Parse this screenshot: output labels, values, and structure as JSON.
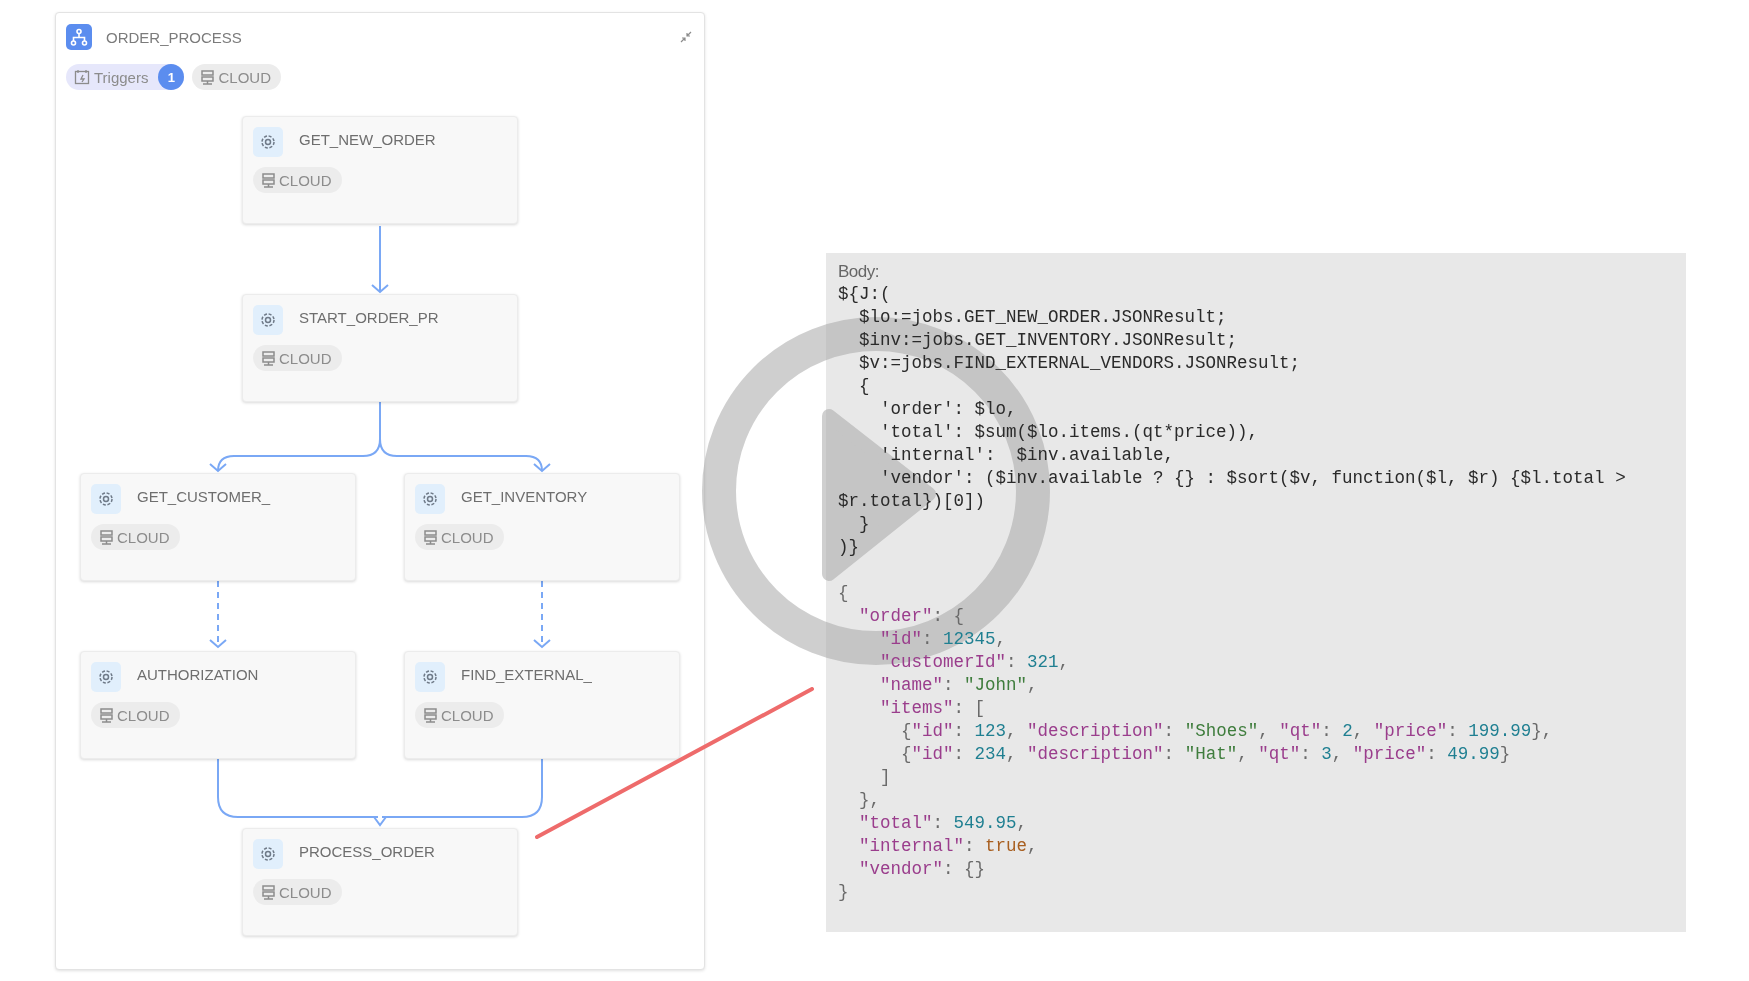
{
  "diagram": {
    "title": "ORDER_PROCESS",
    "chips": [
      {
        "kind": "triggers",
        "label": "Triggers",
        "count": "1"
      },
      {
        "kind": "location",
        "label": "CLOUD"
      }
    ],
    "nodes": [
      {
        "title": "GET_NEW_ORDER",
        "tag": "CLOUD"
      },
      {
        "title": "START_ORDER_PR",
        "tag": "CLOUD"
      },
      {
        "title": "GET_CUSTOMER_",
        "tag": "CLOUD"
      },
      {
        "title": "GET_INVENTORY",
        "tag": "CLOUD"
      },
      {
        "title": "AUTHORIZATION",
        "tag": "CLOUD"
      },
      {
        "title": "FIND_EXTERNAL_",
        "tag": "CLOUD"
      },
      {
        "title": "PROCESS_ORDER",
        "tag": "CLOUD"
      }
    ],
    "edges": [
      {
        "kind": "solid"
      },
      {
        "kind": "solid"
      },
      {
        "kind": "solid"
      },
      {
        "kind": "dashed"
      },
      {
        "kind": "dashed"
      },
      {
        "kind": "solid"
      },
      {
        "kind": "solid"
      }
    ]
  },
  "request": {
    "label": "Body:",
    "code_lines": [
      "${J:(",
      "  $lo:=jobs.GET_NEW_ORDER.JSONResult;",
      "  $inv:=jobs.GET_INVENTORY.JSONResult;",
      "  $v:=jobs.FIND_EXTERNAL_VENDORS.JSONResult;",
      "  {",
      "    'order': $lo,",
      "    'total': $sum($lo.items.(qt*price)),",
      "    'internal':  $inv.available,",
      "    'vendor': ($inv.available ? {} : $sort($v, function($l, $r) {$l.total >",
      "$r.total})[0])",
      "  }",
      ")}"
    ],
    "result_lines": [
      [
        {
          "text": "{",
          "kind": "punct"
        }
      ],
      [
        {
          "text": "  \"order\"",
          "kind": "key"
        },
        {
          "text": ": {",
          "kind": "punct"
        }
      ],
      [
        {
          "text": "    \"id\"",
          "kind": "key"
        },
        {
          "text": ": ",
          "kind": "punct"
        },
        {
          "text": "12345",
          "kind": "number"
        },
        {
          "text": ",",
          "kind": "punct"
        }
      ],
      [
        {
          "text": "    \"customerId\"",
          "kind": "key"
        },
        {
          "text": ": ",
          "kind": "punct"
        },
        {
          "text": "321",
          "kind": "number"
        },
        {
          "text": ",",
          "kind": "punct"
        }
      ],
      [
        {
          "text": "    \"name\"",
          "kind": "key"
        },
        {
          "text": ": ",
          "kind": "punct"
        },
        {
          "text": "\"John\"",
          "kind": "string"
        },
        {
          "text": ",",
          "kind": "punct"
        }
      ],
      [
        {
          "text": "    \"items\"",
          "kind": "key"
        },
        {
          "text": ": [",
          "kind": "punct"
        }
      ],
      [
        {
          "text": "      {",
          "kind": "punct"
        },
        {
          "text": "\"id\"",
          "kind": "key"
        },
        {
          "text": ": ",
          "kind": "punct"
        },
        {
          "text": "123",
          "kind": "number"
        },
        {
          "text": ", ",
          "kind": "punct"
        },
        {
          "text": "\"description\"",
          "kind": "key"
        },
        {
          "text": ": ",
          "kind": "punct"
        },
        {
          "text": "\"Shoes\"",
          "kind": "string"
        },
        {
          "text": ", ",
          "kind": "punct"
        },
        {
          "text": "\"qt\"",
          "kind": "key"
        },
        {
          "text": ": ",
          "kind": "punct"
        },
        {
          "text": "2",
          "kind": "number"
        },
        {
          "text": ", ",
          "kind": "punct"
        },
        {
          "text": "\"price\"",
          "kind": "key"
        },
        {
          "text": ": ",
          "kind": "punct"
        },
        {
          "text": "199.99",
          "kind": "number"
        },
        {
          "text": "},",
          "kind": "punct"
        }
      ],
      [
        {
          "text": "      {",
          "kind": "punct"
        },
        {
          "text": "\"id\"",
          "kind": "key"
        },
        {
          "text": ": ",
          "kind": "punct"
        },
        {
          "text": "234",
          "kind": "number"
        },
        {
          "text": ", ",
          "kind": "punct"
        },
        {
          "text": "\"description\"",
          "kind": "key"
        },
        {
          "text": ": ",
          "kind": "punct"
        },
        {
          "text": "\"Hat\"",
          "kind": "string"
        },
        {
          "text": ", ",
          "kind": "punct"
        },
        {
          "text": "\"qt\"",
          "kind": "key"
        },
        {
          "text": ": ",
          "kind": "punct"
        },
        {
          "text": "3",
          "kind": "number"
        },
        {
          "text": ", ",
          "kind": "punct"
        },
        {
          "text": "\"price\"",
          "kind": "key"
        },
        {
          "text": ": ",
          "kind": "punct"
        },
        {
          "text": "49.99",
          "kind": "number"
        },
        {
          "text": "}",
          "kind": "punct"
        }
      ],
      [
        {
          "text": "    ]",
          "kind": "punct"
        }
      ],
      [
        {
          "text": "  },",
          "kind": "punct"
        }
      ],
      [
        {
          "text": "  \"total\"",
          "kind": "key"
        },
        {
          "text": ": ",
          "kind": "punct"
        },
        {
          "text": "549.95",
          "kind": "number"
        },
        {
          "text": ",",
          "kind": "punct"
        }
      ],
      [
        {
          "text": "  \"internal\"",
          "kind": "key"
        },
        {
          "text": ": ",
          "kind": "punct"
        },
        {
          "text": "true",
          "kind": "bool"
        },
        {
          "text": ",",
          "kind": "punct"
        }
      ],
      [
        {
          "text": "  \"vendor\"",
          "kind": "key"
        },
        {
          "text": ": {}",
          "kind": "punct"
        }
      ],
      [
        {
          "text": "}",
          "kind": "punct"
        }
      ]
    ]
  },
  "overlay": {
    "kind": "play"
  }
}
